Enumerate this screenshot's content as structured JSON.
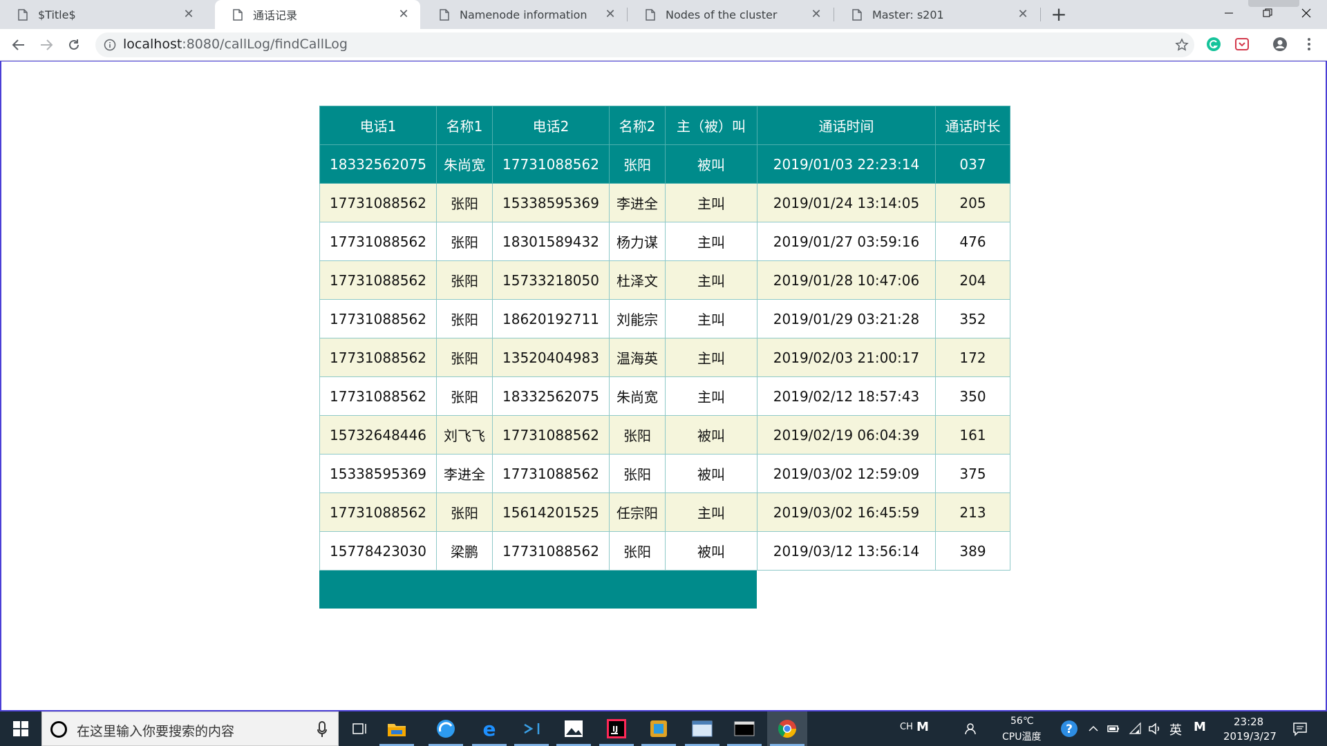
{
  "browser": {
    "tabs": [
      {
        "title": "$Title$",
        "active": false
      },
      {
        "title": "通话记录",
        "active": true
      },
      {
        "title": "Namenode information",
        "active": false
      },
      {
        "title": "Nodes of the cluster",
        "active": false
      },
      {
        "title": "Master: s201",
        "active": false
      }
    ],
    "new_tab_label": "+",
    "url_host": "localhost",
    "url_path": ":8080/callLog/findCallLog"
  },
  "table": {
    "headers": [
      "电话1",
      "名称1",
      "电话2",
      "名称2",
      "主（被）叫",
      "通话时间",
      "通话时长"
    ],
    "rows": [
      [
        "18332562075",
        "朱尚宽",
        "17731088562",
        "张阳",
        "被叫",
        "2019/01/03 22:23:14",
        "037"
      ],
      [
        "17731088562",
        "张阳",
        "15338595369",
        "李进全",
        "主叫",
        "2019/01/24 13:14:05",
        "205"
      ],
      [
        "17731088562",
        "张阳",
        "18301589432",
        "杨力谋",
        "主叫",
        "2019/01/27 03:59:16",
        "476"
      ],
      [
        "17731088562",
        "张阳",
        "15733218050",
        "杜泽文",
        "主叫",
        "2019/01/28 10:47:06",
        "204"
      ],
      [
        "17731088562",
        "张阳",
        "18620192711",
        "刘能宗",
        "主叫",
        "2019/01/29 03:21:28",
        "352"
      ],
      [
        "17731088562",
        "张阳",
        "13520404983",
        "温海英",
        "主叫",
        "2019/02/03 21:00:17",
        "172"
      ],
      [
        "17731088562",
        "张阳",
        "18332562075",
        "朱尚宽",
        "主叫",
        "2019/02/12 18:57:43",
        "350"
      ],
      [
        "15732648446",
        "刘飞飞",
        "17731088562",
        "张阳",
        "被叫",
        "2019/02/19 06:04:39",
        "161"
      ],
      [
        "15338595369",
        "李进全",
        "17731088562",
        "张阳",
        "被叫",
        "2019/03/02 12:59:09",
        "375"
      ],
      [
        "17731088562",
        "张阳",
        "15614201525",
        "任宗阳",
        "主叫",
        "2019/03/02 16:45:59",
        "213"
      ],
      [
        "15778423030",
        "梁鹏",
        "17731088562",
        "张阳",
        "被叫",
        "2019/03/12 13:56:14",
        "389"
      ]
    ],
    "selected_row": 0,
    "colors": {
      "header_bg": "#008b8b",
      "odd_row_bg": "#f5f5dc",
      "even_row_bg": "#ffffff"
    }
  },
  "taskbar": {
    "search_hint": "在这里输入你要搜索的内容",
    "apps": [
      "file-explorer-icon",
      "browser-round-icon",
      "edge-icon",
      "visual-studio-icon",
      "photos-icon",
      "intellij-icon",
      "3d-box-icon",
      "folder-window-icon",
      "terminal-icon",
      "chrome-icon"
    ],
    "tray": {
      "ime_label": "CH",
      "ime_letter": "M",
      "temp": "56℃",
      "cpu_label": "CPU温度",
      "lang": "英",
      "ime_mode": "M",
      "time": "23:28",
      "date": "2019/3/27"
    }
  }
}
